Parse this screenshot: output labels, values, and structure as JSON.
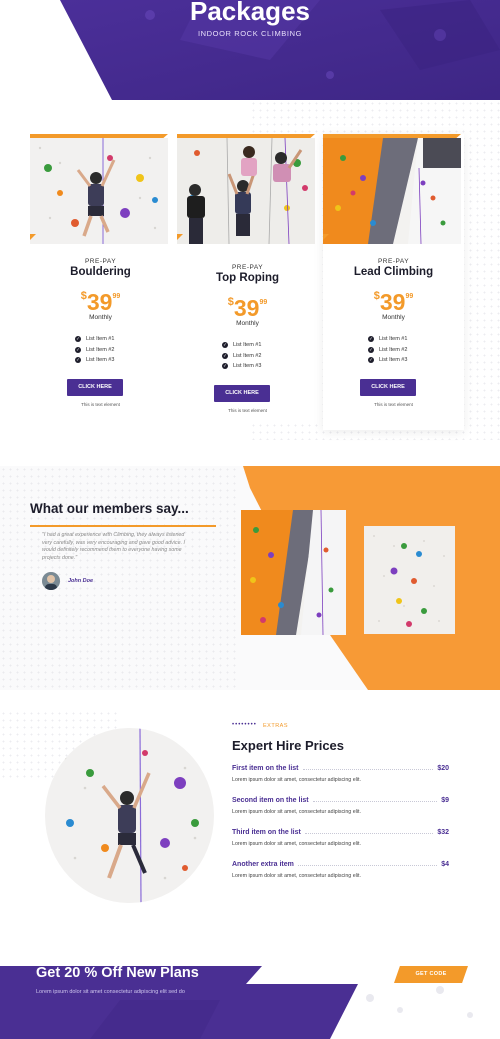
{
  "colors": {
    "purple": "#4a2f93",
    "orange": "#f39a2a",
    "dark": "#1d1d2b"
  },
  "hero": {
    "title": "Packages",
    "subtitle": "INDOOR ROCK CLIMBING"
  },
  "packages": [
    {
      "pre": "PRE-PAY",
      "name": "Bouldering",
      "currency": "$",
      "amount": "39",
      "cents": "99",
      "period": "Monthly",
      "items": [
        "List Item #1",
        "List Item #2",
        "List Item #3"
      ],
      "button": "CLICK HERE",
      "note": "This is text element"
    },
    {
      "pre": "PRE-PAY",
      "name": "Top Roping",
      "currency": "$",
      "amount": "39",
      "cents": "99",
      "period": "Monthly",
      "items": [
        "List Item #1",
        "List Item #2",
        "List Item #3"
      ],
      "button": "CLICK HERE",
      "note": "This is text element"
    },
    {
      "pre": "PRE-PAY",
      "name": "Lead Climbing",
      "currency": "$",
      "amount": "39",
      "cents": "99",
      "period": "Monthly",
      "items": [
        "List Item #1",
        "List Item #2",
        "List Item #3"
      ],
      "button": "CLICK HERE",
      "note": "This is text element"
    }
  ],
  "testimonials": {
    "title": "What our members say...",
    "quote": "\"I had a great experience with Climbing, they always listened very carefully, was very encouraging and gave good advice. I would definitely recommend them to everyone having some projects done.\"",
    "author": "John Doe"
  },
  "hire": {
    "eyebrow_dots": "••••••••",
    "eyebrow": "EXTRAS",
    "title": "Expert Hire Prices",
    "items": [
      {
        "name": "First item on the list",
        "price": "$20",
        "desc": "Lorem ipsum dolor sit amet, consectetur adipiscing elit."
      },
      {
        "name": "Second item on the list",
        "price": "$9",
        "desc": "Lorem ipsum dolor sit amet, consectetur adipiscing elit."
      },
      {
        "name": "Third item on the list",
        "price": "$32",
        "desc": "Lorem ipsum dolor sit amet, consectetur adipiscing elit."
      },
      {
        "name": "Another extra item",
        "price": "$4",
        "desc": "Lorem ipsum dolor sit amet, consectetur adipiscing elit."
      }
    ]
  },
  "promo": {
    "title": "Get 20 % Off New Plans",
    "subtitle": "Lorem ipsum dolor sit amet consectetur adipiscing elit sed do",
    "button": "GET CODE"
  },
  "icons": {
    "check": "check-circle-icon"
  }
}
